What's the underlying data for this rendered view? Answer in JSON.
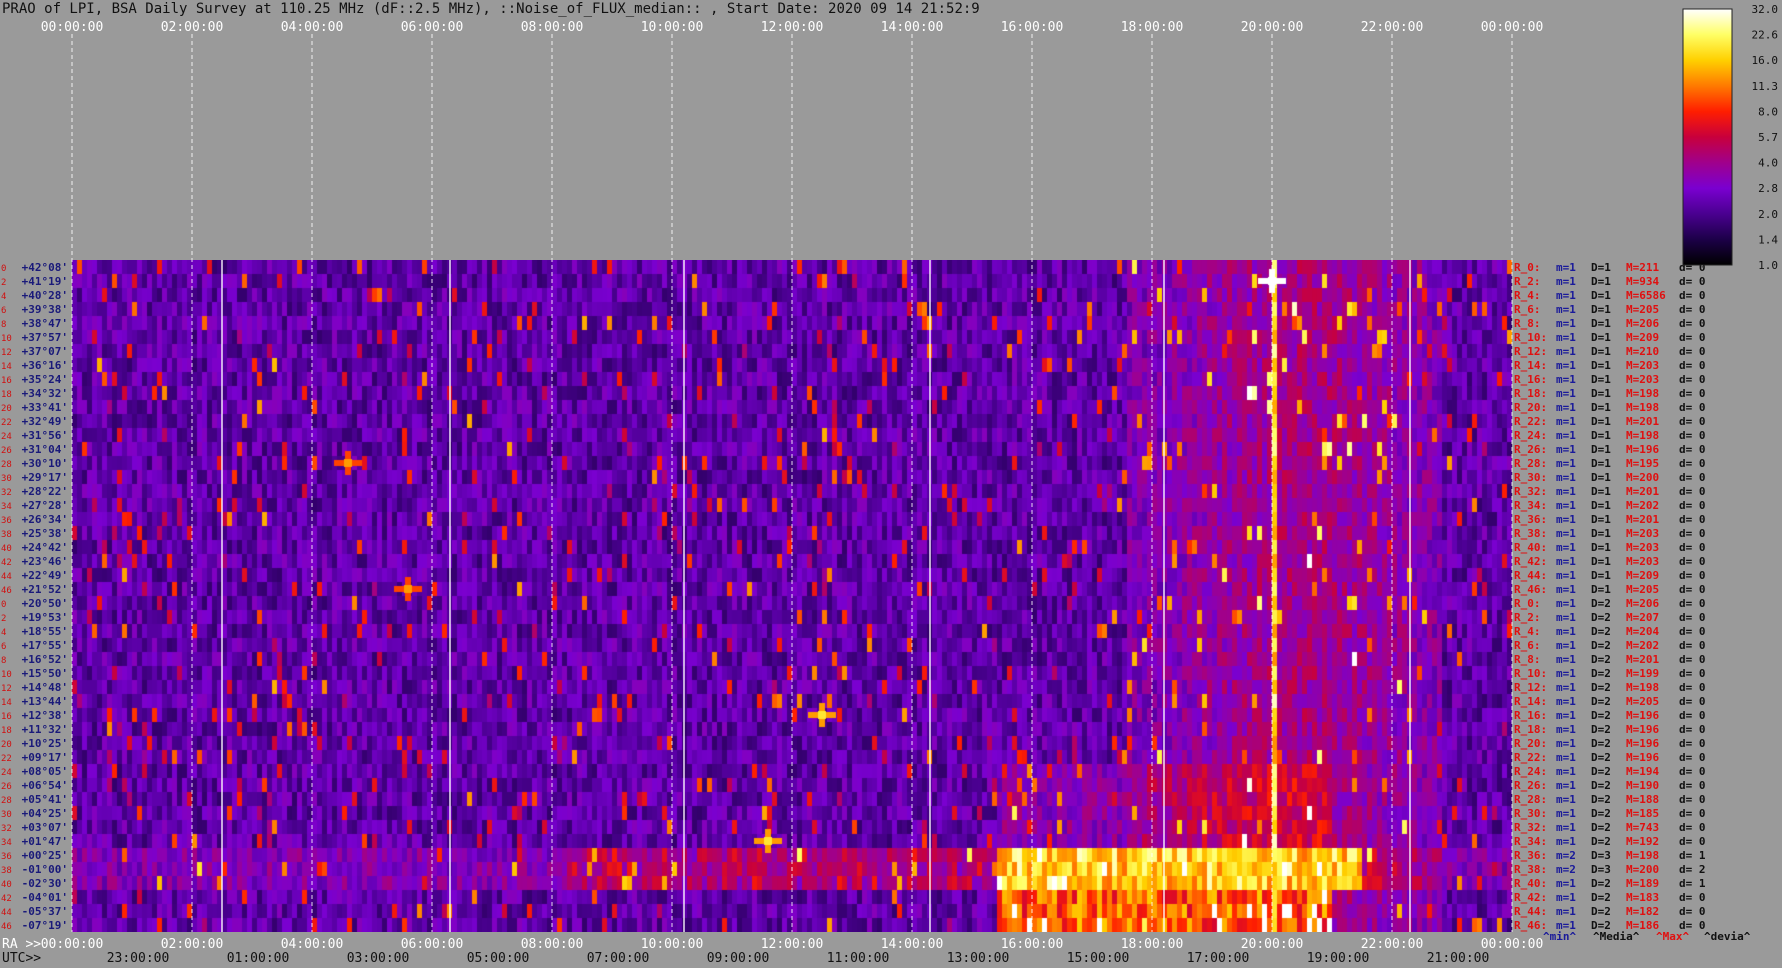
{
  "title": "PRAO of LPI, BSA Daily Survey at 110.25 MHz (dF::2.5 MHz), ::Noise_of_FLUX_median:: , Start Date: 2020 09 14 21:52:9",
  "colorbar": {
    "ticks": [
      "32.0",
      "22.6",
      "16.0",
      "11.3",
      "8.0",
      "5.7",
      "4.0",
      "2.8",
      "2.0",
      "1.4",
      "1.0"
    ],
    "colors": [
      "#ffffff",
      "#ffff66",
      "#ffd000",
      "#ff7a00",
      "#ff1e00",
      "#c8003c",
      "#a0008c",
      "#7a00d0",
      "#4a0090",
      "#1c0048",
      "#000000"
    ]
  },
  "chart_data": {
    "type": "heatmap",
    "x_top_ticks": [
      "00:00:00",
      "02:00:00",
      "04:00:00",
      "06:00:00",
      "08:00:00",
      "10:00:00",
      "12:00:00",
      "14:00:00",
      "16:00:00",
      "18:00:00",
      "20:00:00",
      "22:00:00",
      "00:00:00"
    ],
    "x_bottom_ra_label": "RA >>",
    "x_bottom_ra_ticks": [
      "00:00:00",
      "02:00:00",
      "04:00:00",
      "06:00:00",
      "08:00:00",
      "10:00:00",
      "12:00:00",
      "14:00:00",
      "16:00:00",
      "18:00:00",
      "20:00:00",
      "22:00:00",
      "00:00:00"
    ],
    "x_bottom_utc_label": "UTC>>",
    "x_bottom_utc_ticks": [
      "23:00:00",
      "01:00:00",
      "03:00:00",
      "05:00:00",
      "07:00:00",
      "09:00:00",
      "11:00:00",
      "13:00:00",
      "15:00:00",
      "17:00:00",
      "19:00:00",
      "21:00:00"
    ],
    "declinations": [
      "+42°08'",
      "+41°19'",
      "+40°28'",
      "+39°38'",
      "+38°47'",
      "+37°57'",
      "+37°07'",
      "+36°16'",
      "+35°24'",
      "+34°32'",
      "+33°41'",
      "+32°49'",
      "+31°56'",
      "+31°04'",
      "+30°10'",
      "+29°17'",
      "+28°22'",
      "+27°28'",
      "+26°34'",
      "+25°38'",
      "+24°42'",
      "+23°46'",
      "+22°49'",
      "+21°52'",
      "+20°50'",
      "+19°53'",
      "+18°55'",
      "+17°55'",
      "+16°52'",
      "+15°50'",
      "+14°48'",
      "+13°44'",
      "+12°38'",
      "+11°32'",
      "+10°25'",
      "+09°17'",
      "+08°05'",
      "+06°54'",
      "+05°41'",
      "+04°25'",
      "+03°07'",
      "+01°47'",
      "+00°25'",
      "-01°00'",
      "-02°30'",
      "-04°01'",
      "-05°37'",
      "-07°19'"
    ],
    "row_index": [
      "0",
      "2",
      "4",
      "6",
      "8",
      "10",
      "12",
      "14",
      "16",
      "18",
      "20",
      "22",
      "24",
      "26",
      "28",
      "30",
      "32",
      "34",
      "36",
      "38",
      "40",
      "42",
      "44",
      "46",
      "0",
      "2",
      "4",
      "6",
      "8",
      "10",
      "12",
      "14",
      "16",
      "18",
      "20",
      "22",
      "24",
      "26",
      "28",
      "30",
      "32",
      "34",
      "36",
      "38",
      "40",
      "42",
      "44",
      "46"
    ],
    "row_stats": [
      [
        "R_0:",
        "m=1",
        "D=1",
        "M=211",
        "d= 0"
      ],
      [
        "R_2:",
        "m=1",
        "D=1",
        "M=934",
        "d= 0"
      ],
      [
        "R_4:",
        "m=1",
        "D=1",
        "M=6586",
        "d= 0"
      ],
      [
        "R_6:",
        "m=1",
        "D=1",
        "M=205",
        "d= 0"
      ],
      [
        "R_8:",
        "m=1",
        "D=1",
        "M=206",
        "d= 0"
      ],
      [
        "R_10:",
        "m=1",
        "D=1",
        "M=209",
        "d= 0"
      ],
      [
        "R_12:",
        "m=1",
        "D=1",
        "M=210",
        "d= 0"
      ],
      [
        "R_14:",
        "m=1",
        "D=1",
        "M=203",
        "d= 0"
      ],
      [
        "R_16:",
        "m=1",
        "D=1",
        "M=203",
        "d= 0"
      ],
      [
        "R_18:",
        "m=1",
        "D=1",
        "M=198",
        "d= 0"
      ],
      [
        "R_20:",
        "m=1",
        "D=1",
        "M=198",
        "d= 0"
      ],
      [
        "R_22:",
        "m=1",
        "D=1",
        "M=201",
        "d= 0"
      ],
      [
        "R_24:",
        "m=1",
        "D=1",
        "M=198",
        "d= 0"
      ],
      [
        "R_26:",
        "m=1",
        "D=1",
        "M=196",
        "d= 0"
      ],
      [
        "R_28:",
        "m=1",
        "D=1",
        "M=195",
        "d= 0"
      ],
      [
        "R_30:",
        "m=1",
        "D=1",
        "M=200",
        "d= 0"
      ],
      [
        "R_32:",
        "m=1",
        "D=1",
        "M=201",
        "d= 0"
      ],
      [
        "R_34:",
        "m=1",
        "D=1",
        "M=202",
        "d= 0"
      ],
      [
        "R_36:",
        "m=1",
        "D=1",
        "M=201",
        "d= 0"
      ],
      [
        "R_38:",
        "m=1",
        "D=1",
        "M=203",
        "d= 0"
      ],
      [
        "R_40:",
        "m=1",
        "D=1",
        "M=203",
        "d= 0"
      ],
      [
        "R_42:",
        "m=1",
        "D=1",
        "M=203",
        "d= 0"
      ],
      [
        "R_44:",
        "m=1",
        "D=1",
        "M=209",
        "d= 0"
      ],
      [
        "R_46:",
        "m=1",
        "D=1",
        "M=205",
        "d= 0"
      ],
      [
        "R_0:",
        "m=1",
        "D=2",
        "M=206",
        "d= 0"
      ],
      [
        "R_2:",
        "m=1",
        "D=2",
        "M=207",
        "d= 0"
      ],
      [
        "R_4:",
        "m=1",
        "D=2",
        "M=204",
        "d= 0"
      ],
      [
        "R_6:",
        "m=1",
        "D=2",
        "M=202",
        "d= 0"
      ],
      [
        "R_8:",
        "m=1",
        "D=2",
        "M=201",
        "d= 0"
      ],
      [
        "R_10:",
        "m=1",
        "D=2",
        "M=199",
        "d= 0"
      ],
      [
        "R_12:",
        "m=1",
        "D=2",
        "M=198",
        "d= 0"
      ],
      [
        "R_14:",
        "m=1",
        "D=2",
        "M=205",
        "d= 0"
      ],
      [
        "R_16:",
        "m=1",
        "D=2",
        "M=196",
        "d= 0"
      ],
      [
        "R_18:",
        "m=1",
        "D=2",
        "M=196",
        "d= 0"
      ],
      [
        "R_20:",
        "m=1",
        "D=2",
        "M=196",
        "d= 0"
      ],
      [
        "R_22:",
        "m=1",
        "D=2",
        "M=196",
        "d= 0"
      ],
      [
        "R_24:",
        "m=1",
        "D=2",
        "M=194",
        "d= 0"
      ],
      [
        "R_26:",
        "m=1",
        "D=2",
        "M=190",
        "d= 0"
      ],
      [
        "R_28:",
        "m=1",
        "D=2",
        "M=188",
        "d= 0"
      ],
      [
        "R_30:",
        "m=1",
        "D=2",
        "M=185",
        "d= 0"
      ],
      [
        "R_32:",
        "m=1",
        "D=2",
        "M=743",
        "d= 0"
      ],
      [
        "R_34:",
        "m=1",
        "D=2",
        "M=192",
        "d= 0"
      ],
      [
        "R_36:",
        "m=2",
        "D=3",
        "M=198",
        "d= 1"
      ],
      [
        "R_38:",
        "m=2",
        "D=3",
        "M=200",
        "d= 2"
      ],
      [
        "R_40:",
        "m=1",
        "D=2",
        "M=189",
        "d= 1"
      ],
      [
        "R_42:",
        "m=1",
        "D=2",
        "M=183",
        "d= 0"
      ],
      [
        "R_44:",
        "m=1",
        "D=2",
        "M=182",
        "d= 0"
      ],
      [
        "R_46:",
        "m=1",
        "D=2",
        "M=186",
        "d= 0"
      ]
    ],
    "legend_items": [
      {
        "label": "^min^",
        "color": "#1a1a9a"
      },
      {
        "label": "^Media^",
        "color": "#111111"
      },
      {
        "label": "^Max^",
        "color": "#e01010"
      },
      {
        "label": "^devia^",
        "color": "#111111"
      }
    ],
    "bright_sources": [
      {
        "ra_hours": 20.0,
        "dec_row": 1,
        "level": 32.0
      },
      {
        "ra_hours": 11.6,
        "dec_row": 41,
        "level": 16.0
      },
      {
        "ra_hours": 5.6,
        "dec_row": 23,
        "level": 11.3
      },
      {
        "ra_hours": 4.6,
        "dec_row": 14,
        "level": 11.3
      },
      {
        "ra_hours": 12.5,
        "dec_row": 32,
        "level": 16.0
      }
    ]
  }
}
